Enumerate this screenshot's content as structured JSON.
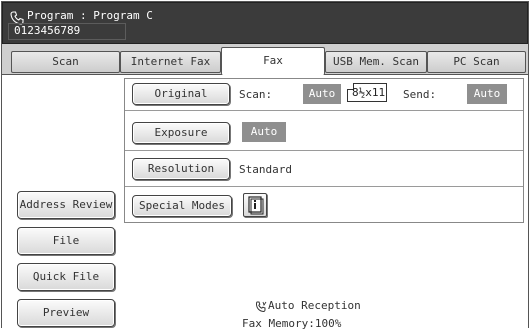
{
  "header": {
    "program_line": "Program : Program C",
    "number": "0123456789",
    "icon": "phone-handset-icon"
  },
  "tabs": [
    {
      "label": "Scan",
      "active": false
    },
    {
      "label": "Internet Fax",
      "active": false
    },
    {
      "label": "Fax",
      "active": true
    },
    {
      "label": "USB Mem. Scan",
      "active": false
    },
    {
      "label": "PC Scan",
      "active": false
    }
  ],
  "settings": {
    "original_button": "Original",
    "scan_label": "Scan:",
    "scan_value": "Auto",
    "paper_size": "8½x11",
    "send_label": "Send:",
    "send_value": "Auto",
    "exposure_button": "Exposure",
    "exposure_value": "Auto",
    "resolution_button": "Resolution",
    "resolution_value": "Standard",
    "special_modes_button": "Special Modes",
    "info_icon": "info-icon"
  },
  "side_buttons": {
    "address_review": "Address Review",
    "file": "File",
    "quick_file": "Quick File",
    "preview": "Preview"
  },
  "status": {
    "reception": "Auto Reception",
    "memory": "Fax Memory:100%",
    "reception_icon": "fax-handset-icon"
  },
  "colors": {
    "header_bg": "#3b3b3b",
    "auto_badge_bg": "#8f8f8f",
    "frame_bg": "#cfcfcf"
  }
}
